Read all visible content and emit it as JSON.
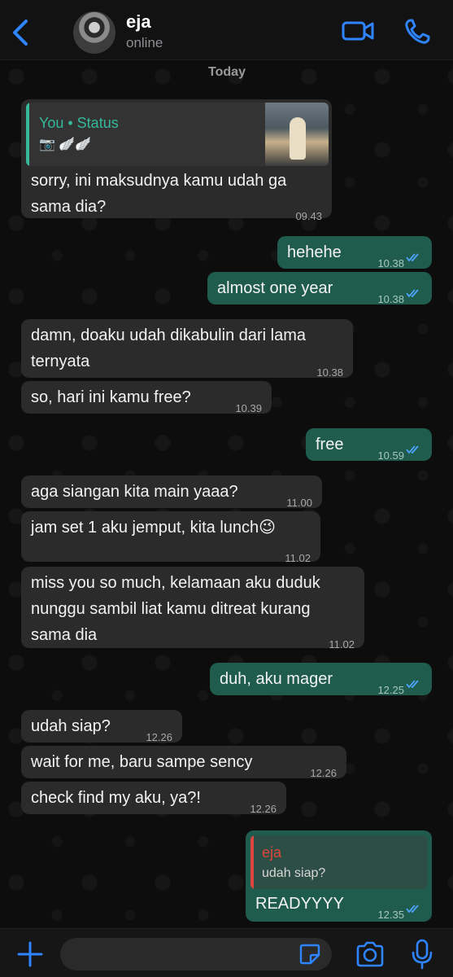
{
  "header": {
    "contact_name": "eja",
    "contact_status": "online"
  },
  "chat": {
    "day_label": "Today",
    "status_reply": {
      "quote_title": "You • Status",
      "quote_icons": "📷 🪽🪽",
      "text_lines": [
        "sorry, ini maksudnya kamu udah ga",
        "sama dia?"
      ],
      "time": "09.43"
    },
    "messages": [
      {
        "dir": "out",
        "lines": [
          "hehehe"
        ],
        "time": "10.38"
      },
      {
        "dir": "out",
        "lines": [
          "almost one year"
        ],
        "time": "10.38"
      },
      {
        "dir": "in",
        "lines": [
          "damn, doaku udah dikabulin dari lama",
          "ternyata"
        ],
        "time": "10.38"
      },
      {
        "dir": "in",
        "lines": [
          "so, hari ini kamu free?"
        ],
        "time": "10.39"
      },
      {
        "dir": "out",
        "lines": [
          "free"
        ],
        "time": "10.59"
      },
      {
        "dir": "in",
        "lines": [
          "aga siangan kita main yaaa?"
        ],
        "time": "11.00"
      },
      {
        "dir": "in",
        "lines": [
          "jam set 1 aku jemput, kita lunch😉"
        ],
        "time": "11.02"
      },
      {
        "dir": "in",
        "lines": [
          "miss you so much, kelamaan aku duduk",
          "nunggu sambil liat kamu ditreat kurang",
          "sama dia"
        ],
        "time": "11.02"
      },
      {
        "dir": "out",
        "lines": [
          "duh, aku mager"
        ],
        "time": "12.25"
      },
      {
        "dir": "in",
        "lines": [
          "udah siap?"
        ],
        "time": "12.26"
      },
      {
        "dir": "in",
        "lines": [
          "wait for me, baru sampe sency"
        ],
        "time": "12.26"
      },
      {
        "dir": "in",
        "lines": [
          "check find my aku, ya?!"
        ],
        "time": "12.26"
      }
    ],
    "reply_message": {
      "quote_name": "eja",
      "quote_text": "udah siap?",
      "text": "READYYYY",
      "time": "12.35"
    }
  },
  "composer": {
    "placeholder": ""
  },
  "colors": {
    "accent": "#2f84ff",
    "outgoing_bubble": "#1f5c4d",
    "incoming_bubble": "#2b2b2b",
    "status_green": "#35b89b",
    "quote_red": "#e0453d"
  },
  "icons": [
    "back-chevron-icon",
    "video-camera-icon",
    "phone-icon",
    "plus-icon",
    "sticker-icon",
    "camera-icon",
    "microphone-icon",
    "read-ticks-icon"
  ]
}
